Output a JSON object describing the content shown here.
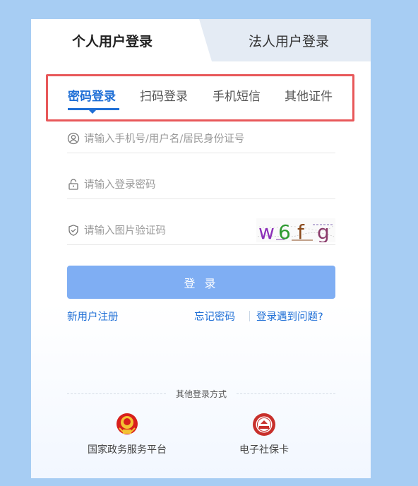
{
  "tabs": {
    "personal": "个人用户登录",
    "legal": "法人用户登录"
  },
  "methods": [
    "密码登录",
    "扫码登录",
    "手机短信",
    "其他证件"
  ],
  "fields": {
    "account_placeholder": "请输入手机号/用户名/居民身份证号",
    "password_placeholder": "请输入登录密码",
    "captcha_placeholder": "请输入图片验证码",
    "captcha_text": "w6fg"
  },
  "login_button": "登 录",
  "links": {
    "register": "新用户注册",
    "forgot": "忘记密码",
    "problem": "登录遇到问题?"
  },
  "other": {
    "title": "其他登录方式",
    "items": [
      {
        "label": "国家政务服务平台",
        "icon": "national-emblem-icon"
      },
      {
        "label": "电子社保卡",
        "icon": "social-security-card-icon"
      }
    ]
  },
  "colors": {
    "accent": "#1f6fd6",
    "button": "#7faef3",
    "highlight_box": "#e8585a",
    "background": "#a7cdf3"
  }
}
